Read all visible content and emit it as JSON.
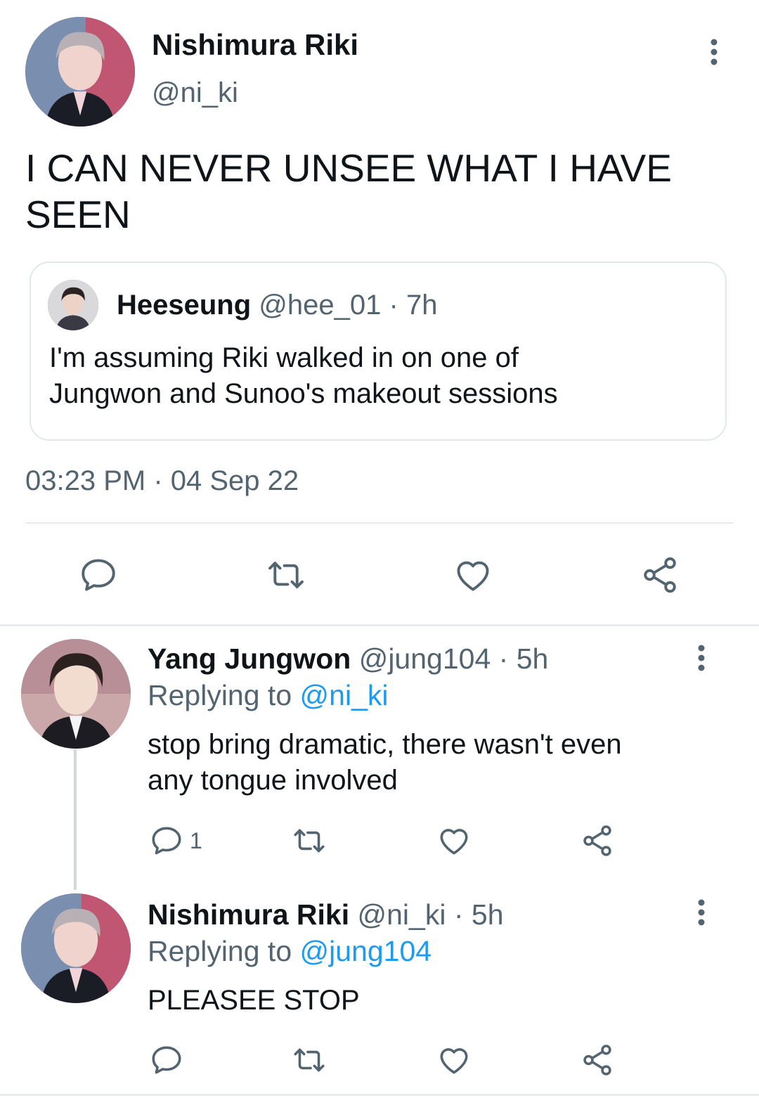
{
  "main_tweet": {
    "author_name": "Nishimura Riki",
    "handle": "@ni_ki",
    "text_line1": "I CAN NEVER UNSEE WHAT I HAVE",
    "text_line2": "SEEN",
    "quoted": {
      "author_name": "Heeseung",
      "handle": "@hee_01",
      "time": "· 7h",
      "text_line1": "I'm assuming Riki walked in on one of",
      "text_line2": "Jungwon and Sunoo's makeout sessions"
    },
    "timestamp": "03:23 PM · 04 Sep 22"
  },
  "replies": [
    {
      "author_name": "Yang Jungwon",
      "handle": "@jung104",
      "time": "· 5h",
      "replying_label": "Replying to",
      "replying_to": "@ni_ki",
      "text_line1": "stop bring dramatic, there wasn't even",
      "text_line2": "any tongue involved",
      "reply_count": "1"
    },
    {
      "author_name": "Nishimura Riki",
      "handle": "@ni_ki",
      "time": "· 5h",
      "replying_label": "Replying to",
      "replying_to": "@jung104",
      "text_line1": "PLEASEE STOP"
    }
  ],
  "icons": [
    "more-icon",
    "reply-icon",
    "retweet-icon",
    "like-icon",
    "share-icon"
  ],
  "colors": {
    "link": "#1d9bf0",
    "muted": "#536471",
    "text": "#0f1419",
    "divider": "#e6ecf0"
  }
}
